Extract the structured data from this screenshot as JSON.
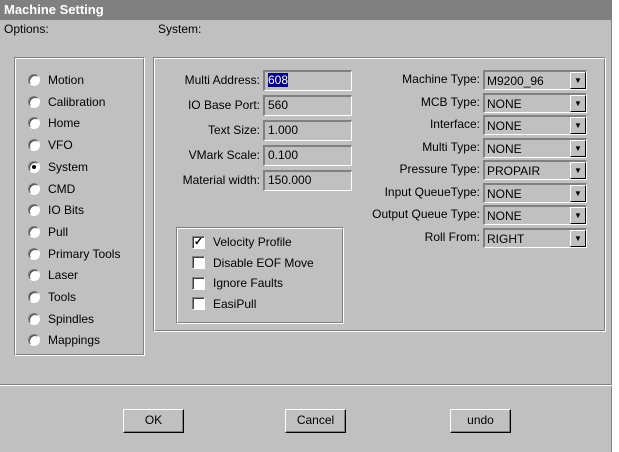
{
  "window": {
    "title": "Machine Setting"
  },
  "options": {
    "label": "Options:",
    "items": [
      {
        "label": "Motion",
        "selected": false
      },
      {
        "label": "Calibration",
        "selected": false
      },
      {
        "label": "Home",
        "selected": false
      },
      {
        "label": "VFO",
        "selected": false
      },
      {
        "label": "System",
        "selected": true
      },
      {
        "label": "CMD",
        "selected": false
      },
      {
        "label": "IO Bits",
        "selected": false
      },
      {
        "label": "Pull",
        "selected": false
      },
      {
        "label": "Primary Tools",
        "selected": false
      },
      {
        "label": "Laser",
        "selected": false
      },
      {
        "label": "Tools",
        "selected": false
      },
      {
        "label": "Spindles",
        "selected": false
      },
      {
        "label": "Mappings",
        "selected": false
      }
    ]
  },
  "system": {
    "label": "System:",
    "fields": [
      {
        "label": "Multi Address:",
        "value": "608"
      },
      {
        "label": "IO Base Port:",
        "value": "560"
      },
      {
        "label": "Text Size:",
        "value": "1.000"
      },
      {
        "label": "VMark Scale:",
        "value": "0.100"
      },
      {
        "label": "Material width:",
        "value": "150.000"
      }
    ],
    "checks": [
      {
        "label": "Velocity Profile",
        "checked": true
      },
      {
        "label": "Disable EOF Move",
        "checked": false
      },
      {
        "label": "Ignore Faults",
        "checked": false
      },
      {
        "label": "EasiPull",
        "checked": false
      }
    ],
    "combos": [
      {
        "label": "Machine Type:",
        "value": "M9200_96"
      },
      {
        "label": "MCB Type:",
        "value": "NONE"
      },
      {
        "label": "Interface:",
        "value": "NONE"
      },
      {
        "label": "Multi Type:",
        "value": "NONE"
      },
      {
        "label": "Pressure Type:",
        "value": "PROPAIR"
      },
      {
        "label": "Input QueueType:",
        "value": "NONE"
      },
      {
        "label": "Output Queue Type:",
        "value": "NONE"
      },
      {
        "label": "Roll From:",
        "value": "RIGHT"
      }
    ]
  },
  "buttons": {
    "ok": "OK",
    "cancel": "Cancel",
    "undo": "undo"
  }
}
